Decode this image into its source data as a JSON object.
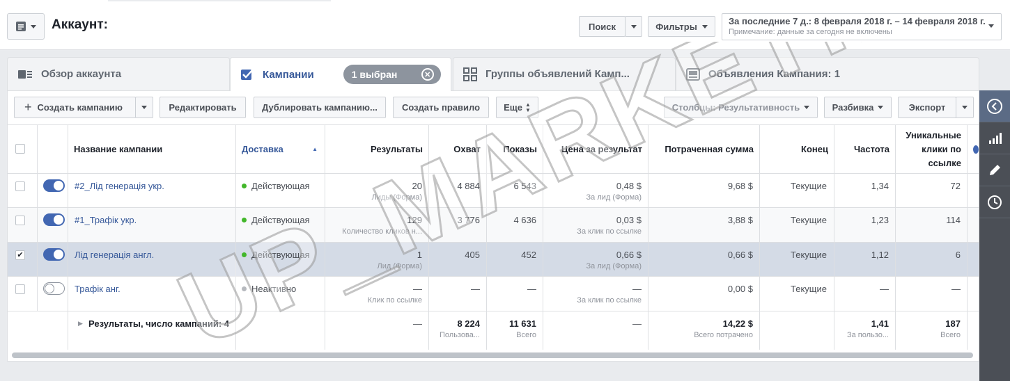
{
  "header": {
    "account_title": "Аккаунт:",
    "search_label": "Поиск",
    "filters_label": "Фильтры",
    "date_range": "За последние 7 д.: 8 февраля 2018 г. – 14 февраля 2018 г.",
    "date_note": "Примечание: данные за сегодня не включены"
  },
  "tabs": [
    {
      "label": "Обзор аккаунта",
      "icon": "overview-icon"
    },
    {
      "label": "Кампании",
      "icon": "checkbox-icon",
      "selected_badge": "1 выбран"
    },
    {
      "label": "Группы объявлений Камп...",
      "icon": "grid-icon"
    },
    {
      "label": "Объявления Кампания: 1",
      "icon": "ad-icon"
    }
  ],
  "toolbar": {
    "create": "Создать кампанию",
    "edit": "Редактировать",
    "duplicate": "Дублировать кампанию...",
    "create_rule": "Создать правило",
    "more": "Еще",
    "columns": "Столбцы: Результативность",
    "breakdown": "Разбивка",
    "export": "Экспорт"
  },
  "table": {
    "headers": {
      "name": "Название кампании",
      "delivery": "Доставка",
      "results": "Результаты",
      "reach": "Охват",
      "impressions": "Показы",
      "cost": "Цена за результат",
      "spent": "Потраченная сумма",
      "end": "Конец",
      "frequency": "Частота",
      "unique_clicks": "Уникальные клики по ссылке"
    },
    "rows": [
      {
        "name": "#2_Лід генерація укр.",
        "delivery": "Действующая",
        "results": "20",
        "results_sub": "Лиды (Форма)",
        "reach": "4 884",
        "impressions": "6 543",
        "cost": "0,48 $",
        "cost_sub": "За лид (Форма)",
        "spent": "9,68 $",
        "end": "Текущие",
        "frequency": "1,34",
        "unique_clicks": "72"
      },
      {
        "name": "#1_Трафік укр.",
        "delivery": "Действующая",
        "results": "129",
        "results_sub": "Количество кликов н...",
        "reach": "3 776",
        "impressions": "4 636",
        "cost": "0,03 $",
        "cost_sub": "За клик по ссылке",
        "spent": "3,88 $",
        "end": "Текущие",
        "frequency": "1,23",
        "unique_clicks": "114"
      },
      {
        "name": "Лід генерація англ.",
        "delivery": "Действующая",
        "results": "1",
        "results_sub": "Лид (Форма)",
        "reach": "405",
        "impressions": "452",
        "cost": "0,66 $",
        "cost_sub": "За лид (Форма)",
        "spent": "0,66 $",
        "end": "Текущие",
        "frequency": "1,12",
        "unique_clicks": "6"
      },
      {
        "name": "Трафік анг.",
        "delivery": "Неактивно",
        "results": "—",
        "results_sub": "Клик по ссылке",
        "reach": "—",
        "impressions": "—",
        "cost": "—",
        "cost_sub": "За клик по ссылке",
        "spent": "0,00 $",
        "end": "Текущие",
        "frequency": "—",
        "unique_clicks": "—"
      }
    ],
    "summary": {
      "label": "Результаты, число кампаний: 4",
      "results": "—",
      "reach": "8 224",
      "reach_sub": "Пользова...",
      "impressions": "11 631",
      "impressions_sub": "Всего",
      "cost": "—",
      "spent": "14,22 $",
      "spent_sub": "Всего потрачено",
      "frequency": "1,41",
      "frequency_sub": "За пользо...",
      "unique_clicks": "187",
      "unique_clicks_sub": "Всего"
    }
  },
  "watermark": "UP_MARKETING",
  "colors": {
    "active": "#42b72a",
    "inactive": "#90949c",
    "brand": "#4267b2",
    "link": "#365899"
  }
}
